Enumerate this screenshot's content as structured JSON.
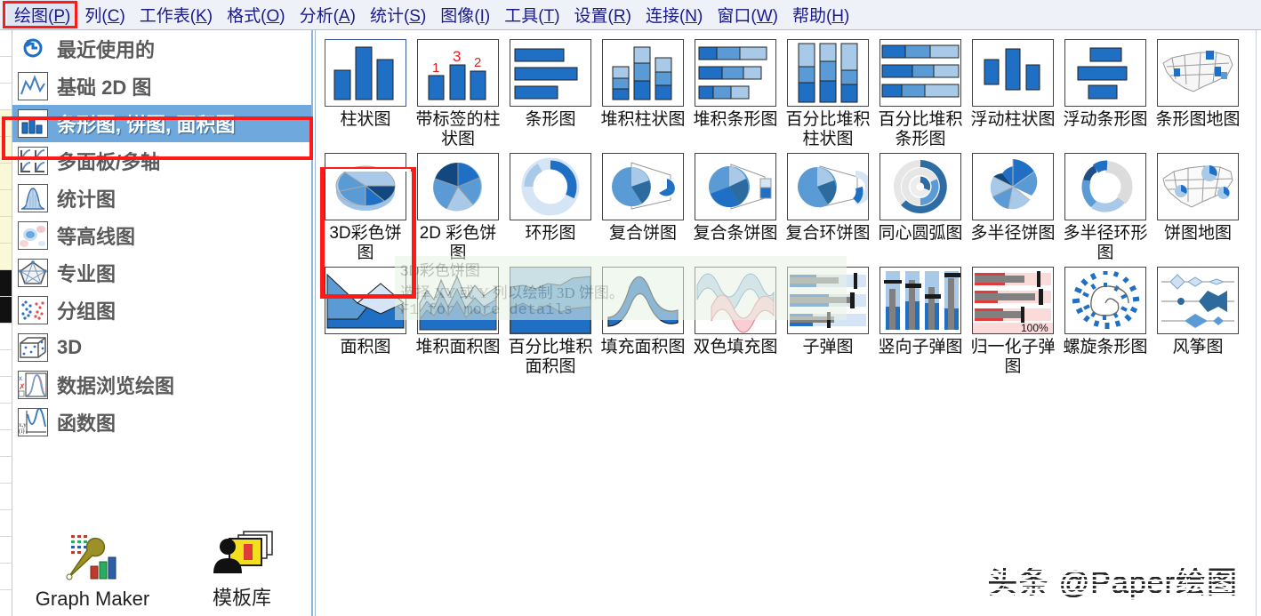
{
  "menu": {
    "items": [
      {
        "label": "绘图",
        "acc": "P",
        "active": true
      },
      {
        "label": "列",
        "acc": "C",
        "active": false
      },
      {
        "label": "工作表",
        "acc": "K",
        "active": false
      },
      {
        "label": "格式",
        "acc": "O",
        "active": false
      },
      {
        "label": "分析",
        "acc": "A",
        "active": false
      },
      {
        "label": "统计",
        "acc": "S",
        "active": false
      },
      {
        "label": "图像",
        "acc": "I",
        "active": false
      },
      {
        "label": "工具",
        "acc": "T",
        "active": false
      },
      {
        "label": "设置",
        "acc": "R",
        "active": false
      },
      {
        "label": "连接",
        "acc": "N",
        "active": false
      },
      {
        "label": "窗口",
        "acc": "W",
        "active": false
      },
      {
        "label": "帮助",
        "acc": "H",
        "active": false
      }
    ]
  },
  "sidebar": {
    "items": [
      {
        "label": "最近使用的",
        "icon": "recent-clock-icon",
        "selected": false
      },
      {
        "label": "基础 2D 图",
        "icon": "basic-2d-plot-icon",
        "selected": false
      },
      {
        "label": "条形图, 饼图, 面积图",
        "icon": "bar-pie-area-icon",
        "selected": true
      },
      {
        "label": "多面板/多轴",
        "icon": "multi-panel-axis-icon",
        "selected": false
      },
      {
        "label": "统计图",
        "icon": "statistics-icon",
        "selected": false
      },
      {
        "label": "等高线图",
        "icon": "contour-icon",
        "selected": false
      },
      {
        "label": "专业图",
        "icon": "specialized-icon",
        "selected": false
      },
      {
        "label": "分组图",
        "icon": "grouped-icon",
        "selected": false
      },
      {
        "label": "3D",
        "icon": "cube-3d-icon",
        "selected": false
      },
      {
        "label": "数据浏览绘图",
        "icon": "data-explorer-icon",
        "selected": false
      },
      {
        "label": "函数图",
        "icon": "function-plot-icon",
        "selected": false
      }
    ],
    "bottom_buttons": [
      {
        "label": "Graph Maker",
        "icon": "graph-maker-icon"
      },
      {
        "label": "模板库",
        "icon": "template-library-icon"
      }
    ]
  },
  "gallery": {
    "rows": [
      [
        {
          "label": "柱状图",
          "icon": "column-chart-icon",
          "selected_border": true
        },
        {
          "label": "带标签的柱状图",
          "icon": "labeled-column-chart-icon"
        },
        {
          "label": "条形图",
          "icon": "bar-chart-icon"
        },
        {
          "label": "堆积柱状图",
          "icon": "stacked-column-icon"
        },
        {
          "label": "堆积条形图",
          "icon": "stacked-bar-icon"
        },
        {
          "label": "百分比堆积柱状图",
          "icon": "percent-stacked-column-icon"
        },
        {
          "label": "百分比堆积条形图",
          "icon": "percent-stacked-bar-icon"
        },
        {
          "label": "浮动柱状图",
          "icon": "floating-column-icon"
        },
        {
          "label": "浮动条形图",
          "icon": "floating-bar-icon"
        },
        {
          "label": "条形图地图",
          "icon": "bar-map-icon"
        }
      ],
      [
        {
          "label": "3D彩色饼图",
          "icon": "pie-3d-color-icon",
          "highlighted": true
        },
        {
          "label": "2D 彩色饼图",
          "icon": "pie-2d-color-icon"
        },
        {
          "label": "环形图",
          "icon": "doughnut-icon"
        },
        {
          "label": "复合饼图",
          "icon": "pie-of-pie-icon"
        },
        {
          "label": "复合条饼图",
          "icon": "bar-of-pie-icon"
        },
        {
          "label": "复合环饼图",
          "icon": "doughnut-of-pie-icon"
        },
        {
          "label": "同心圆弧图",
          "icon": "concentric-arc-icon"
        },
        {
          "label": "多半径饼图",
          "icon": "multi-radius-pie-icon"
        },
        {
          "label": "多半径环形图",
          "icon": "multi-radius-doughnut-icon"
        },
        {
          "label": "饼图地图",
          "icon": "pie-map-icon"
        }
      ],
      [
        {
          "label": "面积图",
          "icon": "area-chart-icon"
        },
        {
          "label": "堆积面积图",
          "icon": "stacked-area-icon"
        },
        {
          "label": "百分比堆积面积图",
          "icon": "percent-stacked-area-icon"
        },
        {
          "label": "填充面积图",
          "icon": "fill-area-icon"
        },
        {
          "label": "双色填充图",
          "icon": "two-color-fill-icon"
        },
        {
          "label": "子弹图",
          "icon": "bullet-chart-icon"
        },
        {
          "label": "竖向子弹图",
          "icon": "vertical-bullet-icon"
        },
        {
          "label": "归一化子弹图",
          "icon": "normalized-bullet-icon",
          "overlay_label": "100%"
        },
        {
          "label": "螺旋条形图",
          "icon": "spiral-bar-icon"
        },
        {
          "label": "风筝图",
          "icon": "kite-chart-icon"
        }
      ]
    ]
  },
  "tooltip": {
    "title": "3D彩色饼图",
    "description": "选择 XY 或 Y 列以绘制 3D 饼图。",
    "hint": "F1 for more details"
  },
  "watermark": {
    "text": "头条 @Paper绘图"
  },
  "colors": {
    "accent_blue": "#1f6fc4",
    "highlight_red": "#ff1a1a",
    "selection_blue": "#6fa8dc",
    "menubar_bg": "#eef1f8",
    "menu_text": "#1a1a8c",
    "tooltip_bg": "#e7f3e2"
  }
}
